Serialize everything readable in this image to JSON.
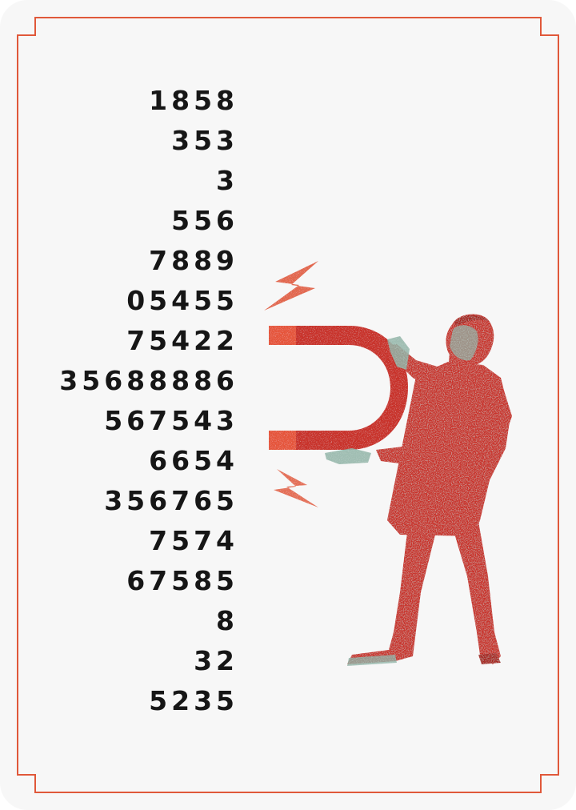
{
  "numbers": [
    "1858",
    "353",
    "3",
    "556",
    "7889",
    "05455",
    "75422",
    "35688886",
    "567543",
    "6654",
    "356765",
    "7574",
    "67585",
    "8",
    "32",
    "5235"
  ],
  "colors": {
    "card_background": "#f7f7f7",
    "frame_line": "#e0583a",
    "digits": "#161616",
    "magnet_red": "#c8312c",
    "magnet_tip": "#e5543a",
    "figure_red": "#c9302c",
    "figure_speckle": "#8fb3a6",
    "spark": "#e0583a"
  },
  "icons": {
    "magnet": "horseshoe-magnet-icon",
    "spark": "lightning-spark-icon",
    "figure": "man-silhouette"
  }
}
